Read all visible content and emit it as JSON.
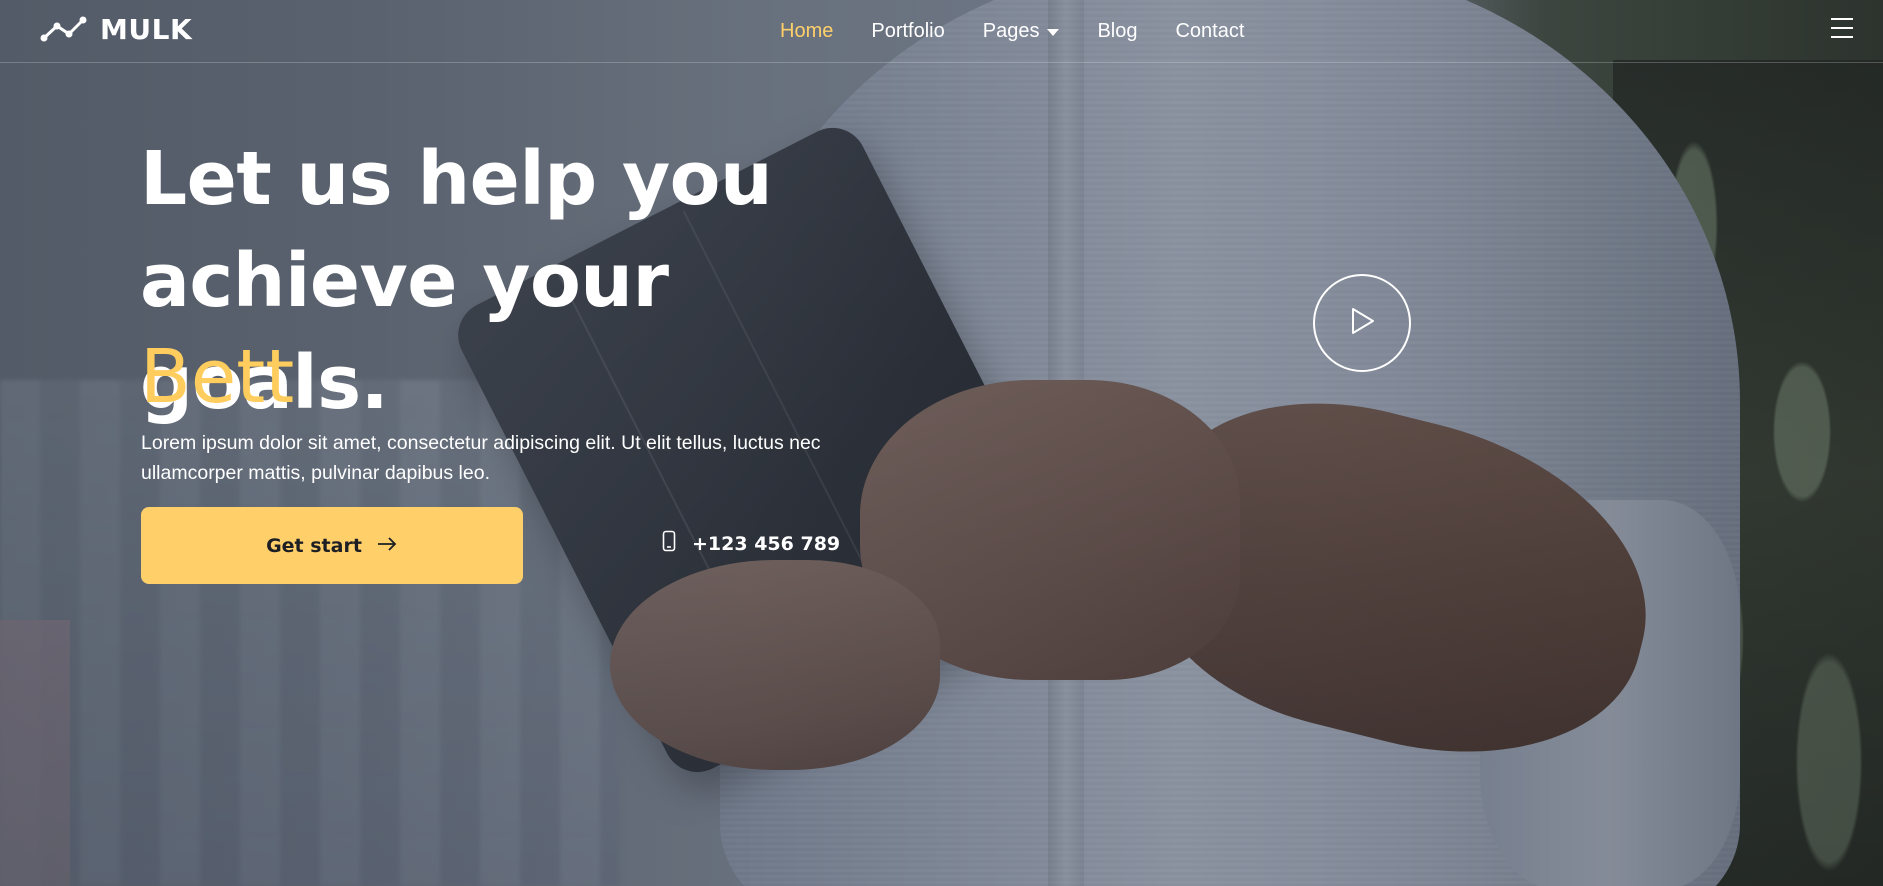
{
  "brand": {
    "name": "MULK",
    "icon": "trend-line-icon"
  },
  "nav": {
    "items": [
      {
        "label": "Home",
        "active": true
      },
      {
        "label": "Portfolio",
        "active": false
      },
      {
        "label": "Pages",
        "active": false,
        "dropdown": true
      },
      {
        "label": "Blog",
        "active": false
      },
      {
        "label": "Contact",
        "active": false
      }
    ],
    "menu_icon": "hamburger-icon"
  },
  "hero": {
    "headline_line1": "Let us help you",
    "headline_line2": "achieve your goals.",
    "typed_word": "Bett",
    "lead": "Lorem ipsum dolor sit amet, consectetur adipiscing elit. Ut elit tellus, luctus nec ullamcorper mattis, pulvinar dapibus leo.",
    "cta_label": "Get start",
    "cta_icon": "arrow-right-icon",
    "phone": "+123 456 789",
    "phone_icon": "smartphone-icon",
    "play_icon": "play-icon"
  },
  "colors": {
    "accent": "#ffd06a",
    "text": "#ffffff",
    "button_text": "#1d1f24"
  }
}
